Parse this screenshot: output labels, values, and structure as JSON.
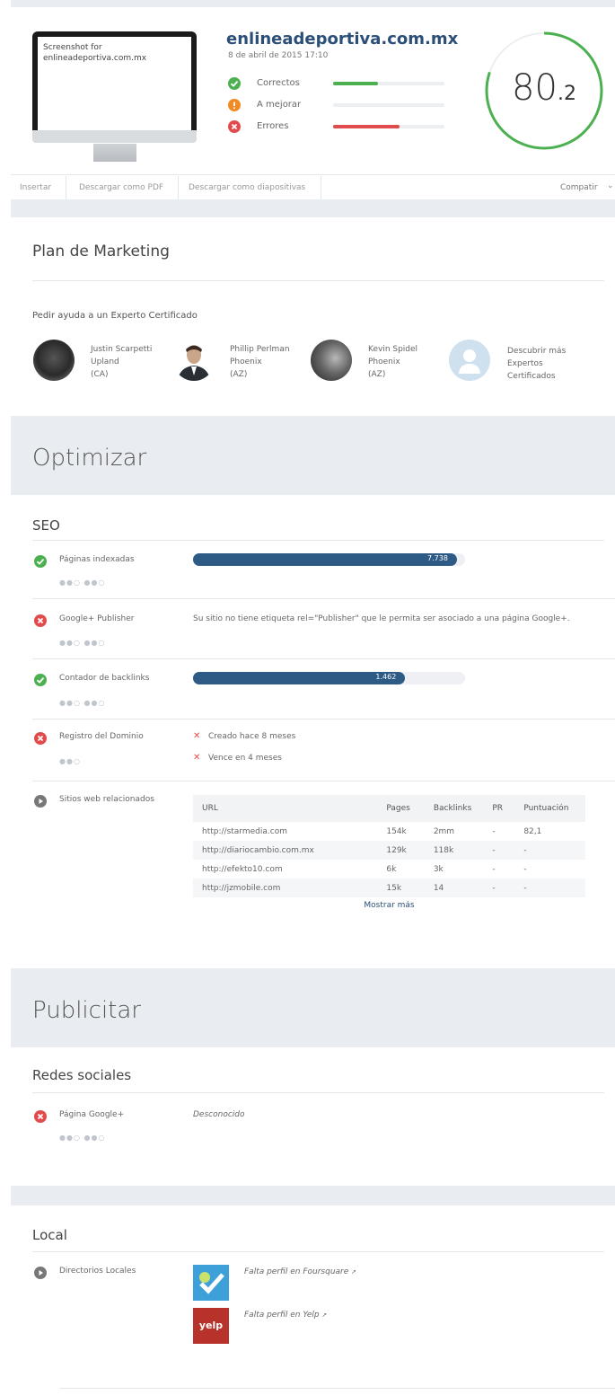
{
  "header": {
    "screenshot_alt": "Screenshot for enlineadeportiva.com.mx",
    "site": "enlineadeportiva.com.mx",
    "date": "8 de abril de 2015 17:10",
    "stats": [
      {
        "label": "Correctos",
        "color": "#4caf50",
        "fill": 0.4
      },
      {
        "label": "A mejorar",
        "color": "#f08a24",
        "fill": 0.0
      },
      {
        "label": "Errores",
        "color": "#e24b4b",
        "fill": 0.6
      }
    ],
    "score_int": "80",
    "score_dec": ".2",
    "score_fraction": 0.802
  },
  "toolbar": {
    "insert": "Insertar",
    "pdf": "Descargar como PDF",
    "slides": "Descargar como diapositivas",
    "share": "Compatir"
  },
  "marketing": {
    "title": "Plan de Marketing",
    "help": "Pedir ayuda a un Experto Certificado",
    "experts": [
      {
        "name": "Justin Scarpetti",
        "city": "Upland",
        "state": "(CA)"
      },
      {
        "name": "Phillip Perlman",
        "city": "Phoenix",
        "state": "(AZ)"
      },
      {
        "name": "Kevin Spidel",
        "city": "Phoenix",
        "state": "(AZ)"
      }
    ],
    "more": [
      "Descubrir más",
      "Expertos",
      "Certificados"
    ]
  },
  "optimize": {
    "title": "Optimizar",
    "seo_title": "SEO",
    "rows": {
      "indexed": {
        "label": "Páginas indexadas",
        "value": "7.738",
        "fill": 0.97
      },
      "gplus": {
        "label": "Google+ Publisher",
        "text": "Su sitio no tiene etiqueta rel=\"Publisher\" que le permita ser asociado a una página Google+."
      },
      "backlinks": {
        "label": "Contador de backlinks",
        "value": "1.462",
        "fill": 0.78
      },
      "domain": {
        "label": "Registro del Dominio",
        "items": [
          "Creado hace 8 meses",
          "Vence en 4 meses"
        ]
      },
      "related": {
        "label": "Sitios web relacionados"
      }
    },
    "table": {
      "headers": [
        "URL",
        "Pages",
        "Backlinks",
        "PR",
        "Puntuación"
      ],
      "rows": [
        [
          "http://starmedia.com",
          "154k",
          "2mm",
          "-",
          "82,1"
        ],
        [
          "http://diariocambio.com.mx",
          "129k",
          "118k",
          "-",
          "-"
        ],
        [
          "http://efekto10.com",
          "6k",
          "3k",
          "-",
          "-"
        ],
        [
          "http://jzmobile.com",
          "15k",
          "14",
          "-",
          "-"
        ]
      ],
      "more": "Mostrar más"
    }
  },
  "advertise": {
    "title": "Publicitar",
    "social_title": "Redes sociales",
    "gplus_label": "Página Google+",
    "gplus_value": "Desconocido"
  },
  "local": {
    "title": "Local",
    "dirs_label": "Directorios Locales",
    "foursquare": "Falta perfil en Foursquare",
    "yelp": "Falta perfil en Yelp",
    "yelp_logo": "yelp"
  },
  "colors": {
    "good": "#4caf50",
    "bad": "#e24b4b",
    "warn": "#f08a24",
    "neutral": "#777",
    "bar": "#2e5a86"
  }
}
